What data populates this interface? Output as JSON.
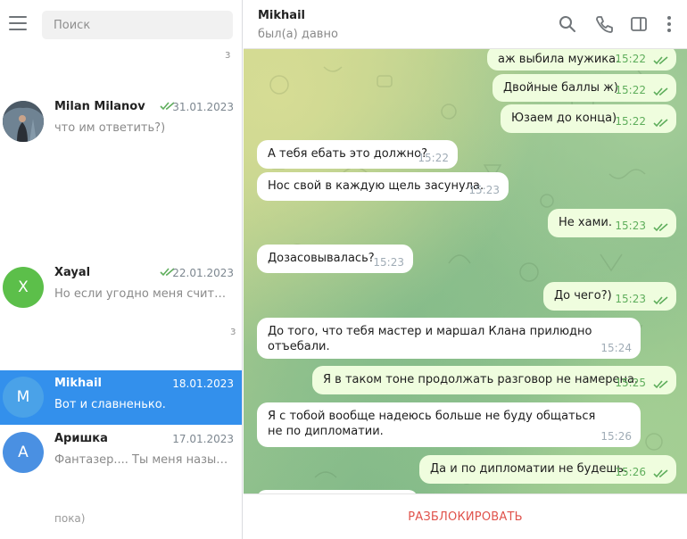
{
  "sidebar": {
    "search_placeholder": "Поиск",
    "top_fragment": "з",
    "mid_fragment": "з",
    "bottom_fragment": "пока)",
    "chats": [
      {
        "name": "Milan Milanov",
        "date": "31.01.2023",
        "preview": "что им ответить?)",
        "read": true,
        "avatar_color": "#5a6a7a",
        "avatar_letter": ""
      },
      {
        "name": "Xayal",
        "date": "22.01.2023",
        "preview": "Но если угодно меня считать ...",
        "read": true,
        "avatar_color": "#5cbf4a",
        "avatar_letter": "X"
      },
      {
        "name": "Mikhail",
        "date": "18.01.2023",
        "preview": "Вот и славненько.",
        "read": false,
        "avatar_color": "#4aa2e8",
        "avatar_letter": "M",
        "active": true
      },
      {
        "name": "Аришка",
        "date": "17.01.2023",
        "preview": "Фантазер.... Ты меня называааа...",
        "read": false,
        "avatar_color": "#4a90e2",
        "avatar_letter": "А"
      }
    ]
  },
  "header": {
    "name": "Mikhail",
    "status": "был(а) давно",
    "icons": [
      "search-icon",
      "phone-icon",
      "sidebar-toggle-icon",
      "more-icon"
    ]
  },
  "messages": [
    {
      "dir": "out",
      "text": "аж выбила мужика.",
      "time": "15:22"
    },
    {
      "dir": "out",
      "text": "Двойные баллы ж)",
      "time": "15:22"
    },
    {
      "dir": "out",
      "text": "Юзаем до конца)",
      "time": "15:22"
    },
    {
      "dir": "in",
      "text": "А тебя ебать это должно?",
      "time": "15:22"
    },
    {
      "dir": "in",
      "text": "Нос свой в каждую щель засунула.",
      "time": "15:23"
    },
    {
      "dir": "out",
      "text": "Не хами.",
      "time": "15:23"
    },
    {
      "dir": "in",
      "text": "Дозасовывалась?",
      "time": "15:23"
    },
    {
      "dir": "out",
      "text": "До чего?)",
      "time": "15:23"
    },
    {
      "dir": "in",
      "text": "До того, что тебя мастер и маршал Клана прилюдно отъебали.",
      "time": "15:24"
    },
    {
      "dir": "out",
      "text": "Я в таком тоне продолжать разговор не намерена.",
      "time": "15:25"
    },
    {
      "dir": "in",
      "text": "Я с тобой вообще надеюсь больше не буду общаться не по дипломатии.",
      "time": "15:26"
    },
    {
      "dir": "out",
      "text": "Да и по дипломатии не будешь.",
      "time": "15:26"
    }
  ],
  "footer": {
    "unblock_label": "РАЗБЛОКИРОВАТЬ"
  },
  "colors": {
    "accent": "#3390ec",
    "outgoing_bubble": "#effdde",
    "danger": "#e0524b",
    "read_tick": "#5fae5c"
  }
}
